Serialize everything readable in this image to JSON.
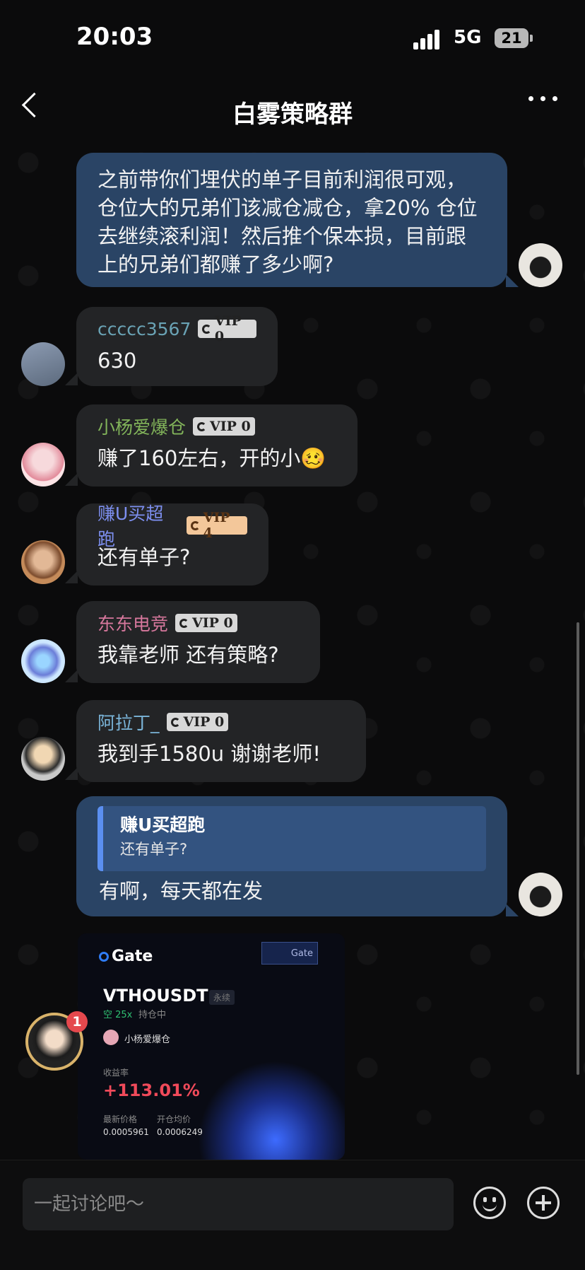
{
  "status_bar": {
    "time": "20:03",
    "network": "5G",
    "battery": "21"
  },
  "header": {
    "title": "白雾策略群"
  },
  "messages": [
    {
      "text": "之前带你们埋伏的单子目前利润很可观，仓位大的兄弟们该减仓减仓，拿20% 仓位去继续滚利润！然后推个保本损，目前跟上的兄弟们都赚了多少啊?"
    },
    {
      "sender": "ccccc3567",
      "sender_color": "#6aa3b5",
      "vip": "VIP 0",
      "text": "630"
    },
    {
      "sender": "小杨爱爆仓",
      "sender_color": "#82b45a",
      "vip": "VIP 0",
      "text": "赚了160左右，开的小🥴"
    },
    {
      "sender": "赚U买超跑",
      "sender_color": "#7d8ff0",
      "vip": "VIP 4",
      "text": "还有单子?"
    },
    {
      "sender": "东东电竞",
      "sender_color": "#d6779c",
      "vip": "VIP 0",
      "text": "我靠老师 还有策略?"
    },
    {
      "sender": "阿拉丁_",
      "sender_color": "#7ab4d8",
      "vip": "VIP 0",
      "text": "我到手1580u  谢谢老师!"
    },
    {
      "quote_sender": "赚U买超跑",
      "quote_text": "还有单子?",
      "text": "有啊，每天都在发"
    }
  ],
  "card": {
    "brand": "Gate",
    "badge": "Gate",
    "pair": "VTHOUSDT",
    "pair_tag": "永续",
    "side": "空 25x",
    "hold": "持仓中",
    "user": "小杨爱爆仓",
    "roi_label": "收益率",
    "roi": "+113.01%",
    "latest_label": "最新价格",
    "open_label": "开仓均价",
    "latest_value": "0.0005961",
    "open_value": "0.0006249"
  },
  "floating": {
    "badge": "1"
  },
  "composer": {
    "placeholder": "一起讨论吧～"
  }
}
